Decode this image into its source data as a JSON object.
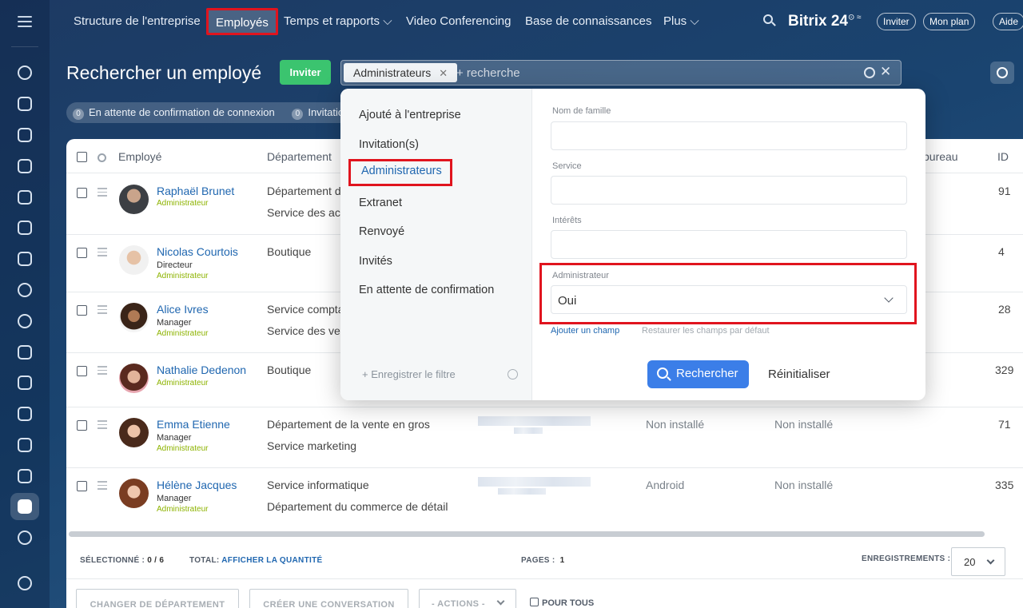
{
  "topnav": {
    "items": [
      "Structure de l'entreprise",
      "Employés",
      "Temps et rapports ⌵",
      "Video Conferencing",
      "Base de connaissances",
      "Plus ⌵"
    ],
    "brand": "Bitrix 24",
    "brand_sup": "⊙ ≈",
    "pills": [
      "Inviter",
      "Mon plan",
      "Aide"
    ]
  },
  "header": {
    "title": "Rechercher un employé",
    "invite_button": "Inviter",
    "filter_chip": "Administrateurs",
    "search_placeholder": "+ recherche"
  },
  "status": {
    "pending_count": "0",
    "pending_label": "En attente de confirmation de connexion",
    "invitations_count": "0",
    "invitations_label": "Invitatio"
  },
  "grid": {
    "headers": {
      "employee": "Employé",
      "department": "Département",
      "office": "bureau",
      "id": "ID"
    },
    "rows": [
      {
        "name": "Raphaël Brunet",
        "position": "",
        "role": "Administrateur",
        "dept1": "Département de",
        "dept2": "Service des ach",
        "mobile": "",
        "desktop": "",
        "id": "91"
      },
      {
        "name": "Nicolas Courtois",
        "position": "Directeur",
        "role": "Administrateur",
        "dept1": "Boutique",
        "dept2": "",
        "mobile": "",
        "desktop": "",
        "id": "4"
      },
      {
        "name": "Alice Ivres",
        "position": "Manager",
        "role": "Administrateur",
        "dept1": "Service compta",
        "dept2": "Service des ver",
        "mobile": "",
        "desktop": "",
        "id": "28"
      },
      {
        "name": "Nathalie Dedenon",
        "position": "",
        "role": "Administrateur",
        "dept1": "Boutique",
        "dept2": "",
        "mobile": "",
        "desktop": "",
        "id": "329"
      },
      {
        "name": "Emma Etienne",
        "position": "Manager",
        "role": "Administrateur",
        "dept1": "Département de la vente en gros",
        "dept2": "Service marketing",
        "mobile": "Non installé",
        "desktop": "Non installé",
        "id": "71"
      },
      {
        "name": "Hélène Jacques",
        "position": "Manager",
        "role": "Administrateur",
        "dept1": "Service informatique",
        "dept2": "Département du commerce de détail",
        "mobile": "Android",
        "desktop": "Non installé",
        "id": "335"
      }
    ]
  },
  "footer": {
    "selected_label": "SÉLECTIONNÉ :",
    "selected_value": "0 / 6",
    "total_label": "TOTAL:",
    "total_link": "AFFICHER LA QUANTITÉ",
    "pages_label": "PAGES :",
    "pages_value": "1",
    "records_label": "ENREGISTREMENTS :",
    "records_value": "20",
    "actions": [
      "CHANGER DE DÉPARTEMENT",
      "CRÉER UNE CONVERSATION",
      "- ACTIONS -"
    ],
    "pour_tous": "POUR TOUS"
  },
  "filter_popup": {
    "presets": [
      "Ajouté à l'entreprise",
      "Invitation(s)",
      "Administrateurs",
      "Extranet",
      "Renvoyé",
      "Invités",
      "En attente de confirmation"
    ],
    "save_filter": "+ Enregistrer le filtre",
    "fields": {
      "lastname": "Nom de famille",
      "service": "Service",
      "interests": "Intérêts",
      "admin": "Administrateur"
    },
    "admin_value": "Oui",
    "add_field": "Ajouter un champ",
    "restore_fields": "Restaurer les champs par défaut",
    "search_button": "Rechercher",
    "reset_button": "Réinitialiser"
  },
  "colors": {
    "accent_blue": "#2067b0",
    "invite_green": "#3bc46f",
    "highlight_red": "#e0141e",
    "search_blue": "#3b7ee8",
    "admin_green": "#8db300"
  },
  "icons": [
    "menu-icon",
    "search-icon",
    "gear-icon",
    "close-icon",
    "chevron-down-icon",
    "drag-handle-icon"
  ]
}
